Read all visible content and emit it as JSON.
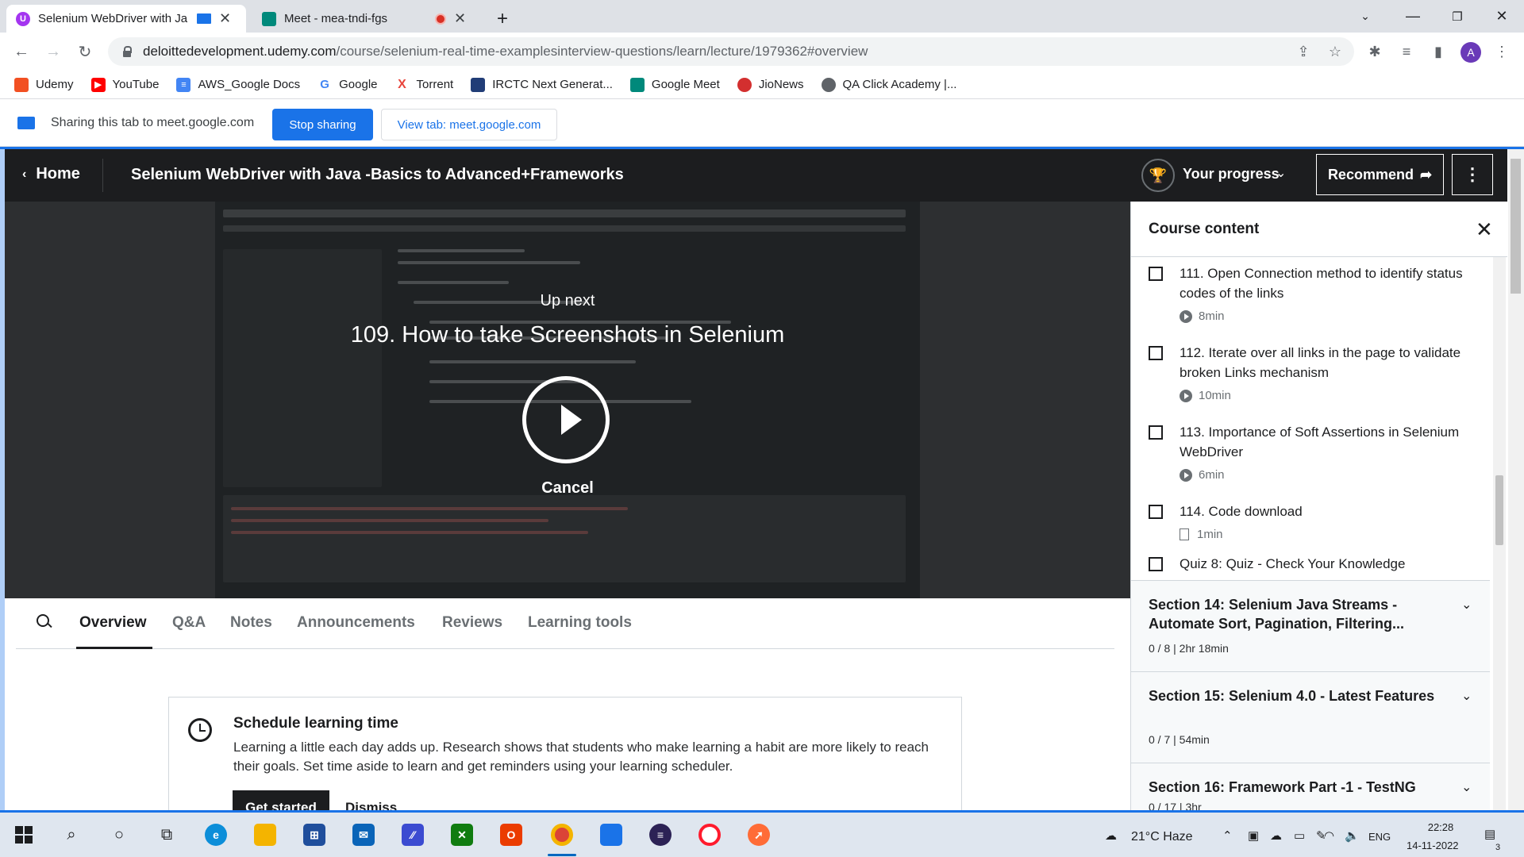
{
  "browser": {
    "tabs": [
      {
        "title": "Selenium WebDriver with Ja",
        "favicon": "udemy-icon"
      },
      {
        "title": "Meet - mea-tndi-fgs",
        "favicon": "google-meet-icon"
      }
    ],
    "url_domain": "deloittedevelopment.udemy.com",
    "url_path": "/course/selenium-real-time-examplesinterview-questions/learn/lecture/1979362#overview",
    "avatar_letter": "A"
  },
  "bookmarks": [
    {
      "label": "Udemy",
      "icon": "udemy-icon",
      "color": "#f25022"
    },
    {
      "label": "YouTube",
      "icon": "youtube-icon",
      "color": "#ff0000"
    },
    {
      "label": "AWS_Google Docs",
      "icon": "docs-icon",
      "color": "#4285f4"
    },
    {
      "label": "Google",
      "icon": "google-icon",
      "color": "#4285f4"
    },
    {
      "label": "Torrent",
      "icon": "torrent-icon",
      "color": "#e8453c"
    },
    {
      "label": "IRCTC Next Generat...",
      "icon": "irctc-icon",
      "color": "#213d77"
    },
    {
      "label": "Google Meet",
      "icon": "meet-icon",
      "color": "#00897b"
    },
    {
      "label": "JioNews",
      "icon": "jionews-icon",
      "color": "#d32f2f"
    },
    {
      "label": "QA Click Academy |...",
      "icon": "globe-icon",
      "color": "#5f6368"
    }
  ],
  "sharebar": {
    "text": "Sharing this tab to meet.google.com",
    "stop_label": "Stop sharing",
    "view_label": "View tab: meet.google.com"
  },
  "header": {
    "home_label": "Home",
    "course_title": "Selenium WebDriver with Java -Basics to Advanced+Frameworks",
    "progress_label": "Your progress",
    "recommend_label": "Recommend"
  },
  "video": {
    "upnext_label": "Up next",
    "upnext_title": "109. How to take Screenshots in Selenium",
    "cancel_label": "Cancel"
  },
  "lesson_tabs": [
    "Overview",
    "Q&A",
    "Notes",
    "Announcements",
    "Reviews",
    "Learning tools"
  ],
  "schedule": {
    "title": "Schedule learning time",
    "body": "Learning a little each day adds up. Research shows that students who make learning a habit are more likely to reach their goals. Set time aside to learn and get reminders using your learning scheduler.",
    "get_started_label": "Get started",
    "dismiss_label": "Dismiss"
  },
  "sidebar": {
    "title": "Course content",
    "lectures": [
      {
        "title": "111. Open Connection method to identify status codes of the links",
        "duration": "8min",
        "type": "video"
      },
      {
        "title": "112. Iterate over all links in the page to validate broken Links mechanism",
        "duration": "10min",
        "type": "video"
      },
      {
        "title": "113. Importance of Soft Assertions in Selenium WebDriver",
        "duration": "6min",
        "type": "video"
      },
      {
        "title": "114. Code download",
        "duration": "1min",
        "type": "file"
      },
      {
        "title": "Quiz 8: Quiz - Check Your Knowledge",
        "duration": "",
        "type": "quiz"
      }
    ],
    "sections": [
      {
        "title": "Section 14: Selenium Java Streams - Automate Sort, Pagination, Filtering...",
        "meta": "0 / 8 | 2hr 18min"
      },
      {
        "title": "Section 15: Selenium 4.0 - Latest Features",
        "meta": "0 / 7 | 54min"
      },
      {
        "title": "Section 16: Framework Part -1 - TestNG",
        "meta": "0 / 17 | 3hr"
      }
    ]
  },
  "taskbar": {
    "weather": "21°C  Haze",
    "lang": "ENG",
    "time": "22:28",
    "date": "14-11-2022",
    "notification_count": "3"
  }
}
